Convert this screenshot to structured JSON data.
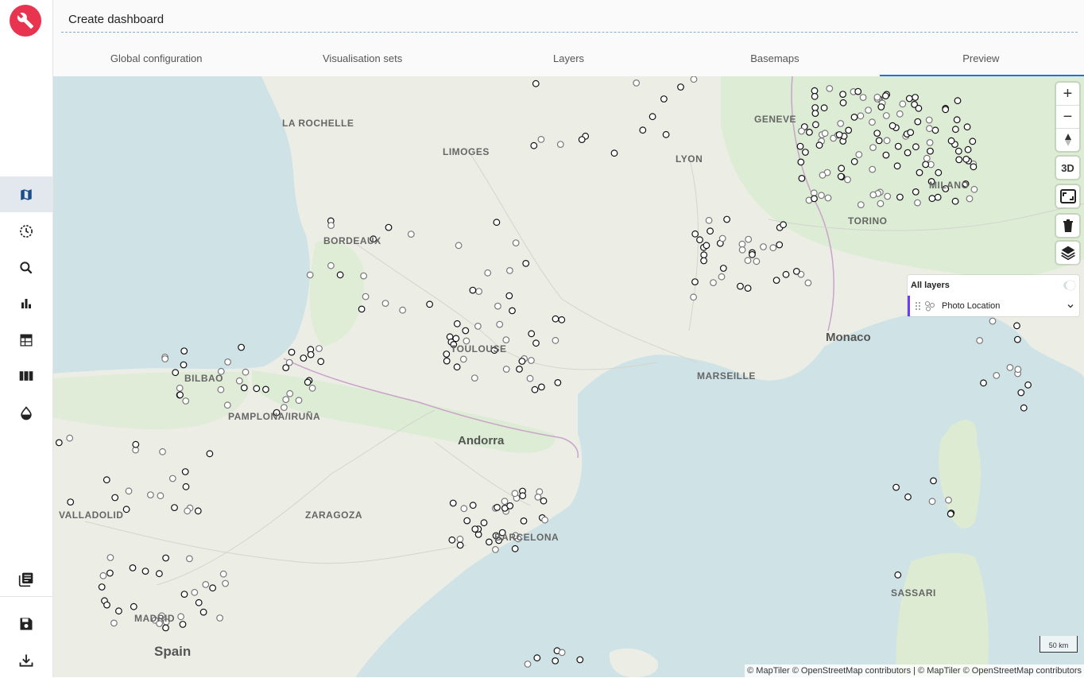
{
  "app": {
    "title": "Create dashboard"
  },
  "tabs": [
    {
      "label": "Global configuration",
      "active": false
    },
    {
      "label": "Visualisation sets",
      "active": false
    },
    {
      "label": "Layers",
      "active": false
    },
    {
      "label": "Basemaps",
      "active": false
    },
    {
      "label": "Preview",
      "active": true
    }
  ],
  "sidebar": {
    "items": [
      {
        "icon": "map-icon",
        "active": true
      },
      {
        "icon": "history-icon"
      },
      {
        "icon": "search-icon"
      },
      {
        "icon": "bar-chart-icon"
      },
      {
        "icon": "table-icon"
      },
      {
        "icon": "columns-icon"
      },
      {
        "icon": "drop-icon"
      }
    ],
    "bottom": [
      {
        "icon": "library-icon"
      },
      {
        "icon": "save-icon"
      },
      {
        "icon": "download-icon"
      }
    ],
    "accent": "#e8344e"
  },
  "map": {
    "controls": {
      "zoom_in": "+",
      "zoom_out": "−",
      "three_d": "3D"
    },
    "layers_panel": {
      "title": "All layers",
      "layers": [
        {
          "name": "Photo Location",
          "color": "#6b3df2"
        }
      ]
    },
    "scale_label": "50 km",
    "attribution": "© MapTiler © OpenStreetMap contributors | © MapTiler © OpenStreetMap contributors",
    "places": [
      {
        "name": "LA ROCHELLE",
        "kind": "city"
      },
      {
        "name": "LIMOGES",
        "kind": "city"
      },
      {
        "name": "GENEVE",
        "kind": "city"
      },
      {
        "name": "LYON",
        "kind": "city"
      },
      {
        "name": "MILANO",
        "kind": "city"
      },
      {
        "name": "TORINO",
        "kind": "city"
      },
      {
        "name": "BORDEAUX",
        "kind": "city"
      },
      {
        "name": "TOULOUSE",
        "kind": "city"
      },
      {
        "name": "MARSEILLE",
        "kind": "city"
      },
      {
        "name": "Monaco",
        "kind": "country"
      },
      {
        "name": "BILBAO",
        "kind": "city"
      },
      {
        "name": "PAMPLONA/IRUÑA",
        "kind": "city"
      },
      {
        "name": "Andorra",
        "kind": "country"
      },
      {
        "name": "VALLADOLID",
        "kind": "city"
      },
      {
        "name": "ZARAGOZA",
        "kind": "city"
      },
      {
        "name": "BARCELONA",
        "kind": "city"
      },
      {
        "name": "SASSARI",
        "kind": "city"
      },
      {
        "name": "MADRID",
        "kind": "city"
      },
      {
        "name": "Spain",
        "kind": "country"
      }
    ],
    "colors": {
      "sea": "#cfe3e6",
      "land": "#eceee6",
      "green": "#dcebd2",
      "border": "#c9a3c8"
    }
  }
}
